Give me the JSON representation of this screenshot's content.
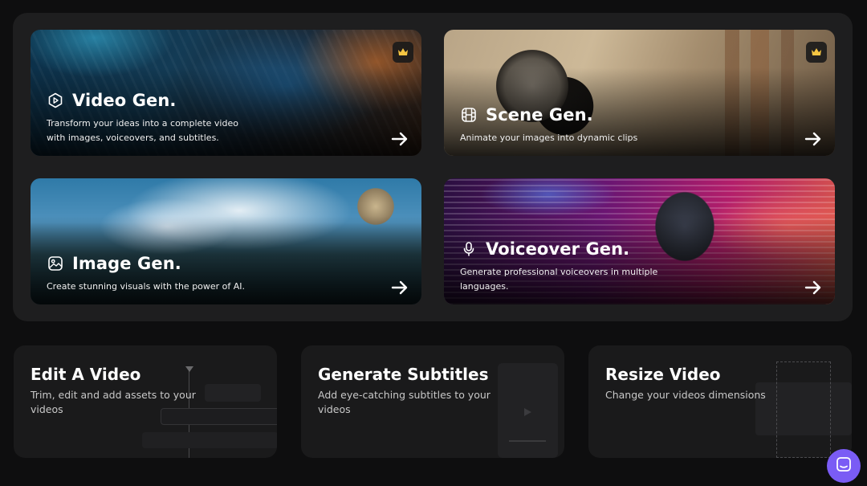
{
  "generators": {
    "video": {
      "title": "Video Gen.",
      "description": "Transform your ideas into a complete video with images, voiceovers, and subtitles.",
      "premium": true,
      "icon": "play-hexagon-icon"
    },
    "scene": {
      "title": "Scene Gen.",
      "description": "Animate your images into dynamic clips",
      "premium": true,
      "icon": "film-icon"
    },
    "image": {
      "title": "Image Gen.",
      "description": "Create stunning visuals with the power of AI.",
      "premium": false,
      "icon": "image-icon"
    },
    "voice": {
      "title": "Voiceover Gen.",
      "description": "Generate professional voiceovers in multiple languages.",
      "premium": false,
      "icon": "microphone-icon"
    }
  },
  "tools": {
    "edit": {
      "title": "Edit A Video",
      "description": "Trim, edit and add assets to your videos"
    },
    "subtitles": {
      "title": "Generate Subtitles",
      "description": "Add eye-catching subtitles to your videos"
    },
    "resize": {
      "title": "Resize Video",
      "description": "Change your videos dimensions"
    }
  },
  "colors": {
    "background": "#0e0e0f",
    "panel": "#1e1e1f",
    "card": "#1a1a1b",
    "chat_button": "#7a5cf5",
    "crown": "#f5c542"
  }
}
